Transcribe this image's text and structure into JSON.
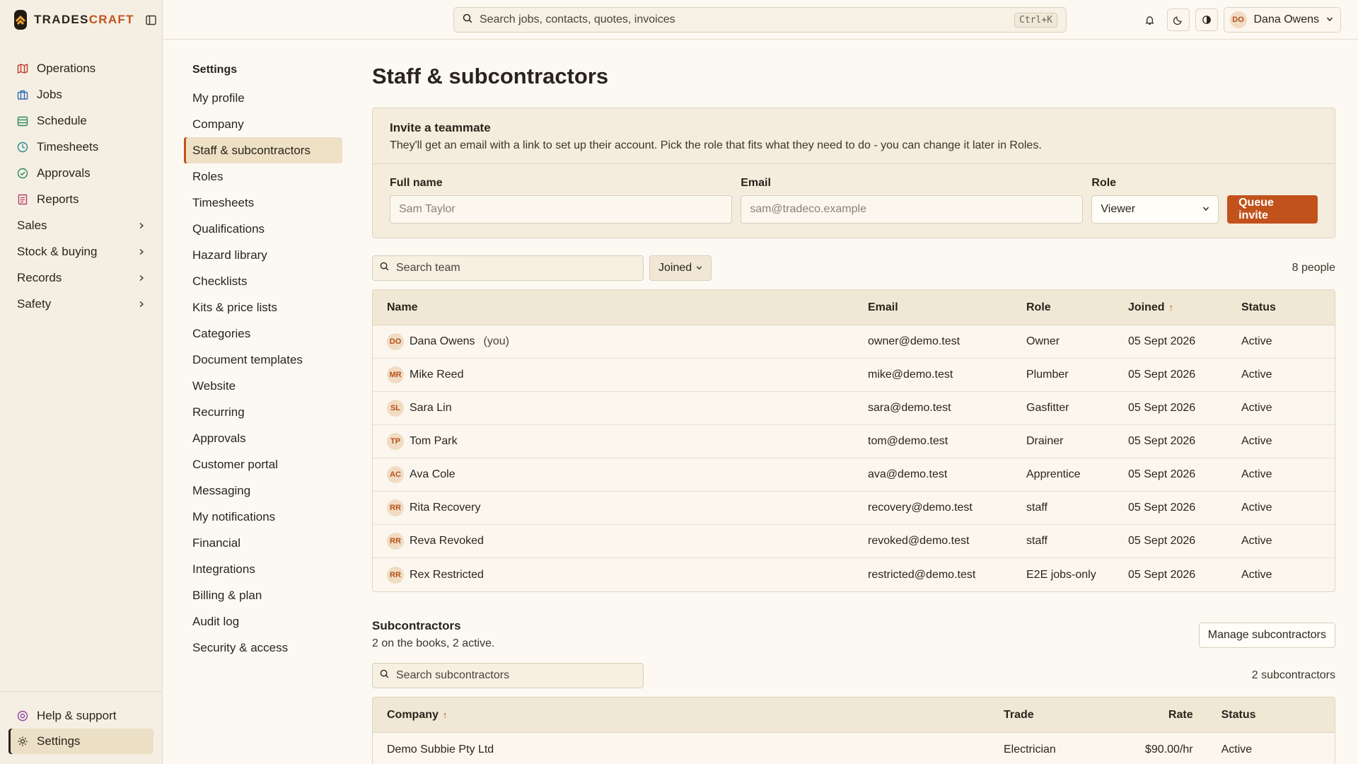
{
  "brand": {
    "part1": "TRADES",
    "part2": "CRAFT"
  },
  "sidebar": {
    "items": [
      {
        "label": "Operations",
        "icon": "map-icon",
        "color": "#c0392b"
      },
      {
        "label": "Jobs",
        "icon": "briefcase-icon",
        "color": "#2f6fb5"
      },
      {
        "label": "Schedule",
        "icon": "calendar-icon",
        "color": "#2e8b57"
      },
      {
        "label": "Timesheets",
        "icon": "clock-icon",
        "color": "#1f8a8a"
      },
      {
        "label": "Approvals",
        "icon": "check-circle-icon",
        "color": "#2e8b57"
      },
      {
        "label": "Reports",
        "icon": "report-icon",
        "color": "#b5426b"
      }
    ],
    "groups": [
      "Sales",
      "Stock & buying",
      "Records",
      "Safety"
    ],
    "bottom": {
      "help": "Help & support",
      "settings": "Settings"
    }
  },
  "topbar": {
    "search_placeholder": "Search jobs, contacts, quotes, invoices",
    "shortcut": "Ctrl+K",
    "user_initials": "DO",
    "user_name": "Dana Owens"
  },
  "settings_nav": {
    "title": "Settings",
    "items": [
      "My profile",
      "Company",
      "Staff & subcontractors",
      "Roles",
      "Timesheets",
      "Qualifications",
      "Hazard library",
      "Checklists",
      "Kits & price lists",
      "Categories",
      "Document templates",
      "Website",
      "Recurring",
      "Approvals",
      "Customer portal",
      "Messaging",
      "My notifications",
      "Financial",
      "Integrations",
      "Billing & plan",
      "Audit log",
      "Security & access"
    ],
    "active": "Staff & subcontractors"
  },
  "page": {
    "title": "Staff & subcontractors"
  },
  "invite": {
    "title": "Invite a teammate",
    "description": "They'll get an email with a link to set up their account. Pick the role that fits what they need to do - you can change it later in Roles.",
    "name_label": "Full name",
    "name_placeholder": "Sam Taylor",
    "email_label": "Email",
    "email_placeholder": "sam@tradeco.example",
    "role_label": "Role",
    "role_value": "Viewer",
    "button": "Queue invite"
  },
  "team": {
    "search_placeholder": "Search team",
    "filter_label": "Joined",
    "count": "8 people",
    "columns": {
      "name": "Name",
      "email": "Email",
      "role": "Role",
      "joined": "Joined",
      "status": "Status"
    },
    "you_label": "(you)",
    "rows": [
      {
        "initials": "DO",
        "name": "Dana Owens",
        "you": true,
        "email": "owner@demo.test",
        "role": "Owner",
        "joined": "05 Sept 2026",
        "status": "Active"
      },
      {
        "initials": "MR",
        "name": "Mike Reed",
        "you": false,
        "email": "mike@demo.test",
        "role": "Plumber",
        "joined": "05 Sept 2026",
        "status": "Active"
      },
      {
        "initials": "SL",
        "name": "Sara Lin",
        "you": false,
        "email": "sara@demo.test",
        "role": "Gasfitter",
        "joined": "05 Sept 2026",
        "status": "Active"
      },
      {
        "initials": "TP",
        "name": "Tom Park",
        "you": false,
        "email": "tom@demo.test",
        "role": "Drainer",
        "joined": "05 Sept 2026",
        "status": "Active"
      },
      {
        "initials": "AC",
        "name": "Ava Cole",
        "you": false,
        "email": "ava@demo.test",
        "role": "Apprentice",
        "joined": "05 Sept 2026",
        "status": "Active"
      },
      {
        "initials": "RR",
        "name": "Rita Recovery",
        "you": false,
        "email": "recovery@demo.test",
        "role": "staff",
        "joined": "05 Sept 2026",
        "status": "Active"
      },
      {
        "initials": "RR",
        "name": "Reva Revoked",
        "you": false,
        "email": "revoked@demo.test",
        "role": "staff",
        "joined": "05 Sept 2026",
        "status": "Active"
      },
      {
        "initials": "RR",
        "name": "Rex Restricted",
        "you": false,
        "email": "restricted@demo.test",
        "role": "E2E jobs-only",
        "joined": "05 Sept 2026",
        "status": "Active"
      }
    ]
  },
  "subcontractors": {
    "title": "Subcontractors",
    "summary": "2 on the books, 2 active.",
    "manage_button": "Manage subcontractors",
    "search_placeholder": "Search subcontractors",
    "count": "2 subcontractors",
    "columns": {
      "company": "Company",
      "trade": "Trade",
      "rate": "Rate",
      "status": "Status"
    },
    "rows": [
      {
        "company": "Demo Subbie Pty Ltd",
        "trade": "Electrician",
        "rate": "$90.00/hr",
        "status": "Active"
      }
    ]
  },
  "colors": {
    "accent": "#c1521b",
    "sidebar_bg": "#f5efe3",
    "page_bg": "#fcf9f3"
  }
}
